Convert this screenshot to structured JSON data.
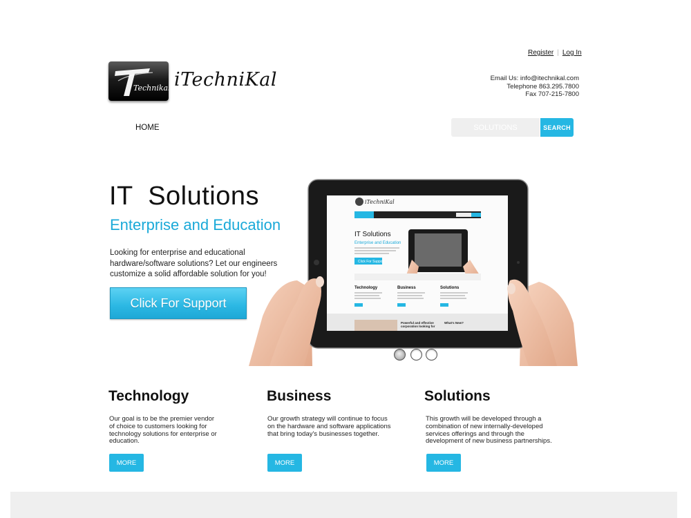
{
  "header": {
    "register_label": "Register",
    "login_label": "Log In",
    "logo_text": "iTechniKal",
    "logo_mark": "Technikal",
    "contact": {
      "email": "Email Us: info@itechnikal.com",
      "telephone": "Telephone 863.295.7800",
      "fax": "Fax 707-215-7800"
    }
  },
  "nav": {
    "home_label": "HOME"
  },
  "search": {
    "placeholder": "SOLUTIONS",
    "button_label": "SEARCH"
  },
  "hero": {
    "title": "IT  Solutions",
    "subtitle": "Enterprise and Education",
    "description": "Looking for enterprise and educational hardware/software solutions? Let our engineers customize a solid affordable solution for you!",
    "cta_label": "Click For Support",
    "slides": {
      "count": 3,
      "active": 1
    },
    "accent_color": "#25b7e3"
  },
  "features": [
    {
      "title": "Technology",
      "text": "Our goal is to be the premier vendor of choice to customers looking for technology solutions for enterprise or education.",
      "button_label": "MORE"
    },
    {
      "title": "Business",
      "text": "Our growth strategy will continue to focus on the hardware and software applications that bring today's businesses together.",
      "button_label": "MORE"
    },
    {
      "title": "Solutions",
      "text": "This growth will be developed through a combination of new internally-developed services offerings and through the development of new business partnerships.",
      "button_label": "MORE"
    }
  ]
}
